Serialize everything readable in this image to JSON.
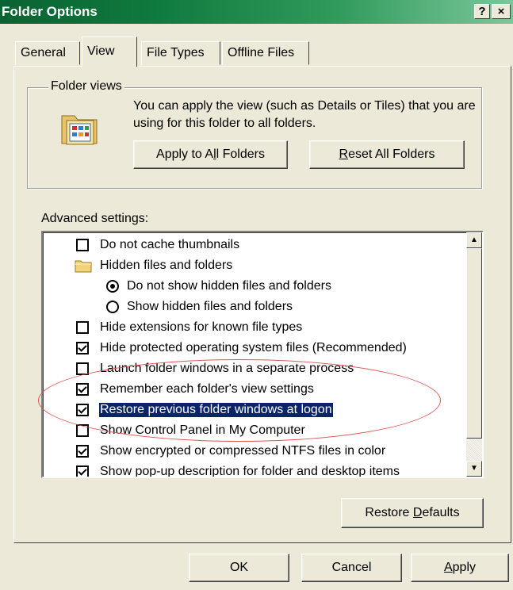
{
  "window": {
    "title": "Folder Options",
    "help_glyph": "?",
    "close_glyph": "×"
  },
  "tabs": [
    {
      "label": "General"
    },
    {
      "label": "View"
    },
    {
      "label": "File Types"
    },
    {
      "label": "Offline Files"
    }
  ],
  "folder_views": {
    "group_label": "Folder views",
    "description": "You can apply the view (such as Details or Tiles) that you are using for this folder to all folders.",
    "apply_button": {
      "pre": "Apply to A",
      "mnemonic": "l",
      "post": "l Folders"
    },
    "reset_button": {
      "pre": "",
      "mnemonic": "R",
      "post": "eset All Folders"
    }
  },
  "advanced": {
    "label": "Advanced settings:",
    "items": [
      {
        "label": "Do not cache thumbnails"
      },
      {
        "label": "Hidden files and folders"
      },
      {
        "label": "Do not show hidden files and folders"
      },
      {
        "label": "Show hidden files and folders"
      },
      {
        "label": "Hide extensions for known file types"
      },
      {
        "label": "Hide protected operating system files (Recommended)"
      },
      {
        "label": "Launch folder windows in a separate process"
      },
      {
        "label": "Remember each folder's view settings"
      },
      {
        "label": "Restore previous folder windows at logon"
      },
      {
        "label": "Show Control Panel in My Computer"
      },
      {
        "label": "Show encrypted or compressed NTFS files in color"
      },
      {
        "label": "Show pop-up description for folder and desktop items"
      }
    ]
  },
  "restore_defaults": {
    "pre": "Restore ",
    "mnemonic": "D",
    "post": "efaults"
  },
  "footer": {
    "ok": "OK",
    "cancel": "Cancel",
    "apply": {
      "pre": "",
      "mnemonic": "A",
      "post": "pply"
    }
  },
  "icons": [
    "folder-options-icon",
    "folder-icon",
    "scroll-up-icon",
    "scroll-down-icon"
  ],
  "colors": {
    "title_bar": "#0f7a3d",
    "selection": "#0a246a",
    "annotation": "#e05555"
  }
}
